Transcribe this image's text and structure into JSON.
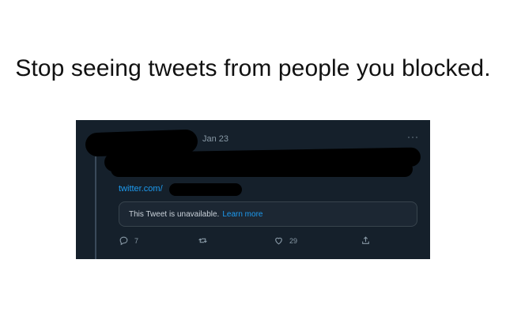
{
  "headline": "Stop seeing tweets from people you blocked.",
  "tweet": {
    "date": "Jan 23",
    "more": "···",
    "link": "twitter.com/",
    "notice": "This Tweet is unavailable.",
    "notice_link": "Learn more",
    "reply_count": "7",
    "retweet_count": "",
    "like_count": "29"
  },
  "colors": {
    "card_bg": "#15202b",
    "accent": "#1d9bf0",
    "muted": "#8899a6"
  }
}
